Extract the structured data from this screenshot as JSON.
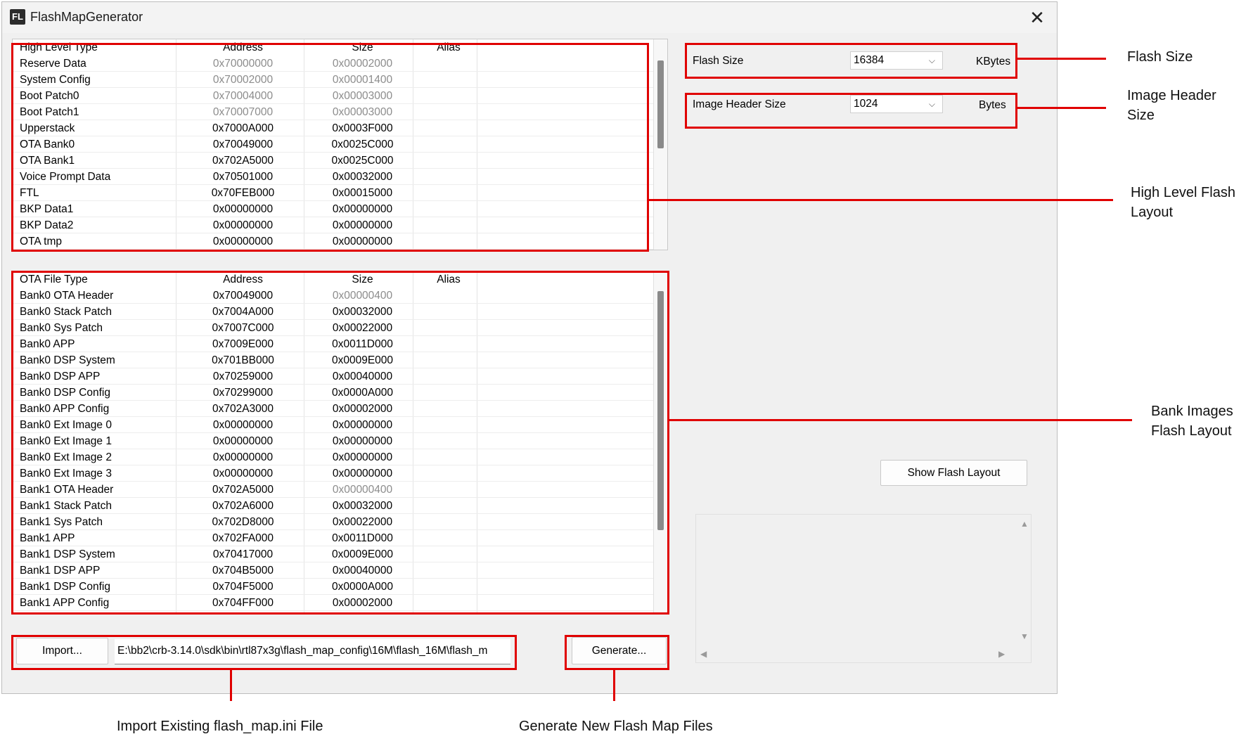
{
  "window": {
    "app_icon": "FL",
    "title": "FlashMapGenerator",
    "close_glyph": "✕"
  },
  "high_level": {
    "headers": [
      "High Level Type",
      "Address",
      "Size",
      "Alias"
    ],
    "rows": [
      {
        "name": "Reserve Data",
        "address": "0x70000000",
        "size": "0x00002000",
        "addr_grey": true,
        "size_grey": true
      },
      {
        "name": "System Config",
        "address": "0x70002000",
        "size": "0x00001400",
        "addr_grey": true,
        "size_grey": true
      },
      {
        "name": "Boot Patch0",
        "address": "0x70004000",
        "size": "0x00003000",
        "addr_grey": true,
        "size_grey": true
      },
      {
        "name": "Boot Patch1",
        "address": "0x70007000",
        "size": "0x00003000",
        "addr_grey": true,
        "size_grey": true
      },
      {
        "name": "Upperstack",
        "address": "0x7000A000",
        "size": "0x0003F000",
        "addr_grey": false,
        "size_grey": false
      },
      {
        "name": "OTA Bank0",
        "address": "0x70049000",
        "size": "0x0025C000",
        "addr_grey": false,
        "size_grey": false
      },
      {
        "name": "OTA Bank1",
        "address": "0x702A5000",
        "size": "0x0025C000",
        "addr_grey": false,
        "size_grey": false
      },
      {
        "name": "Voice Prompt Data",
        "address": "0x70501000",
        "size": "0x00032000",
        "addr_grey": false,
        "size_grey": false
      },
      {
        "name": "FTL",
        "address": "0x70FEB000",
        "size": "0x00015000",
        "addr_grey": false,
        "size_grey": false
      },
      {
        "name": "BKP Data1",
        "address": "0x00000000",
        "size": "0x00000000",
        "addr_grey": false,
        "size_grey": false
      },
      {
        "name": "BKP Data2",
        "address": "0x00000000",
        "size": "0x00000000",
        "addr_grey": false,
        "size_grey": false
      },
      {
        "name": "OTA tmp",
        "address": "0x00000000",
        "size": "0x00000000",
        "addr_grey": false,
        "size_grey": false
      }
    ]
  },
  "ota_files": {
    "headers": [
      "OTA File Type",
      "Address",
      "Size",
      "Alias"
    ],
    "rows": [
      {
        "name": "Bank0 OTA Header",
        "address": "0x70049000",
        "size": "0x00000400",
        "addr_grey": false,
        "size_grey": true
      },
      {
        "name": "Bank0 Stack Patch",
        "address": "0x7004A000",
        "size": "0x00032000",
        "addr_grey": false,
        "size_grey": false
      },
      {
        "name": "Bank0 Sys Patch",
        "address": "0x7007C000",
        "size": "0x00022000",
        "addr_grey": false,
        "size_grey": false
      },
      {
        "name": "Bank0 APP",
        "address": "0x7009E000",
        "size": "0x0011D000",
        "addr_grey": false,
        "size_grey": false
      },
      {
        "name": "Bank0 DSP System",
        "address": "0x701BB000",
        "size": "0x0009E000",
        "addr_grey": false,
        "size_grey": false
      },
      {
        "name": "Bank0 DSP APP",
        "address": "0x70259000",
        "size": "0x00040000",
        "addr_grey": false,
        "size_grey": false
      },
      {
        "name": "Bank0 DSP Config",
        "address": "0x70299000",
        "size": "0x0000A000",
        "addr_grey": false,
        "size_grey": false
      },
      {
        "name": "Bank0 APP Config",
        "address": "0x702A3000",
        "size": "0x00002000",
        "addr_grey": false,
        "size_grey": false
      },
      {
        "name": "Bank0 Ext Image 0",
        "address": "0x00000000",
        "size": "0x00000000",
        "addr_grey": false,
        "size_grey": false
      },
      {
        "name": "Bank0 Ext Image 1",
        "address": "0x00000000",
        "size": "0x00000000",
        "addr_grey": false,
        "size_grey": false
      },
      {
        "name": "Bank0 Ext Image 2",
        "address": "0x00000000",
        "size": "0x00000000",
        "addr_grey": false,
        "size_grey": false
      },
      {
        "name": "Bank0 Ext Image 3",
        "address": "0x00000000",
        "size": "0x00000000",
        "addr_grey": false,
        "size_grey": false
      },
      {
        "name": "Bank1 OTA Header",
        "address": "0x702A5000",
        "size": "0x00000400",
        "addr_grey": false,
        "size_grey": true
      },
      {
        "name": "Bank1 Stack Patch",
        "address": "0x702A6000",
        "size": "0x00032000",
        "addr_grey": false,
        "size_grey": false
      },
      {
        "name": "Bank1 Sys Patch",
        "address": "0x702D8000",
        "size": "0x00022000",
        "addr_grey": false,
        "size_grey": false
      },
      {
        "name": "Bank1 APP",
        "address": "0x702FA000",
        "size": "0x0011D000",
        "addr_grey": false,
        "size_grey": false
      },
      {
        "name": "Bank1 DSP System",
        "address": "0x70417000",
        "size": "0x0009E000",
        "addr_grey": false,
        "size_grey": false
      },
      {
        "name": "Bank1 DSP APP",
        "address": "0x704B5000",
        "size": "0x00040000",
        "addr_grey": false,
        "size_grey": false
      },
      {
        "name": "Bank1 DSP Config",
        "address": "0x704F5000",
        "size": "0x0000A000",
        "addr_grey": false,
        "size_grey": false
      },
      {
        "name": "Bank1 APP Config",
        "address": "0x704FF000",
        "size": "0x00002000",
        "addr_grey": false,
        "size_grey": false
      }
    ]
  },
  "settings": {
    "flash_size_label": "Flash Size",
    "flash_size_value": "16384",
    "flash_size_unit": "KBytes",
    "header_size_label": "Image Header Size",
    "header_size_value": "1024",
    "header_size_unit": "Bytes"
  },
  "buttons": {
    "show_flash_layout": "Show Flash Layout",
    "import": "Import...",
    "generate": "Generate..."
  },
  "import_path": "E:\\bb2\\crb-3.14.0\\sdk\\bin\\rtl87x3g\\flash_map_config\\16M\\flash_16M\\flash_m",
  "annotations": {
    "flash_size": "Flash Size",
    "image_header_1": "Image Header",
    "image_header_2": "Size",
    "high_level_1": "High Level Flash",
    "high_level_2": "Layout",
    "bank_images_1": "Bank Images",
    "bank_images_2": "Flash Layout",
    "import_caption": "Import Existing flash_map.ini File",
    "generate_caption": "Generate New Flash Map Files"
  },
  "colors": {
    "annotation_red": "#e00000",
    "window_bg": "#f0f0f0",
    "disabled_text": "#8c8c8c"
  }
}
